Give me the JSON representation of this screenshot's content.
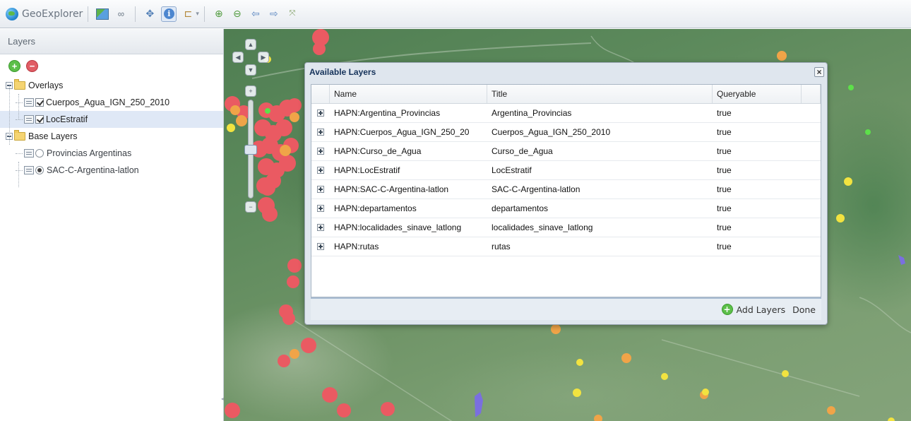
{
  "app": {
    "title": "GeoExplorer"
  },
  "toolbar": {
    "icons": [
      "globe-icon",
      "map-icon",
      "link-icon",
      "pan-icon",
      "info-icon",
      "measure-icon",
      "zoom-in-icon",
      "zoom-out-icon",
      "back-icon",
      "forward-icon",
      "zoom-extent-icon"
    ]
  },
  "layers_panel": {
    "title": "Layers",
    "groups": [
      {
        "label": "Overlays",
        "items": [
          {
            "label": "Cuerpos_Agua_IGN_250_2010",
            "checked": true,
            "selected": false
          },
          {
            "label": "LocEstratif",
            "checked": true,
            "selected": true
          }
        ]
      },
      {
        "label": "Base Layers",
        "items": [
          {
            "label": "Provincias Argentinas",
            "selected": false
          },
          {
            "label": "SAC-C-Argentina-latlon",
            "selected": true
          }
        ]
      }
    ]
  },
  "dialog": {
    "title": "Available Layers",
    "close_symbol": "×",
    "columns": {
      "name": "Name",
      "title": "Title",
      "queryable": "Queryable"
    },
    "rows": [
      {
        "name": "HAPN:Argentina_Provincias",
        "title": "Argentina_Provincias",
        "queryable": "true"
      },
      {
        "name": "HAPN:Cuerpos_Agua_IGN_250_20",
        "title": "Cuerpos_Agua_IGN_250_2010",
        "queryable": "true"
      },
      {
        "name": "HAPN:Curso_de_Agua",
        "title": "Curso_de_Agua",
        "queryable": "true"
      },
      {
        "name": "HAPN:LocEstratif",
        "title": "LocEstratif",
        "queryable": "true"
      },
      {
        "name": "HAPN:SAC-C-Argentina-latlon",
        "title": "SAC-C-Argentina-latlon",
        "queryable": "true"
      },
      {
        "name": "HAPN:departamentos",
        "title": "departamentos",
        "queryable": "true"
      },
      {
        "name": "HAPN:localidades_sinave_latlong",
        "title": "localidades_sinave_latlong",
        "queryable": "true"
      },
      {
        "name": "HAPN:rutas",
        "title": "rutas",
        "queryable": "true"
      }
    ],
    "add_label": "Add Layers",
    "done_label": "Done"
  },
  "colors": {
    "point_red": "#ea5a62",
    "point_orange": "#f0a448",
    "point_yellow": "#f2e340",
    "point_green": "#5de04a",
    "water_purple": "#7a6fe0"
  }
}
